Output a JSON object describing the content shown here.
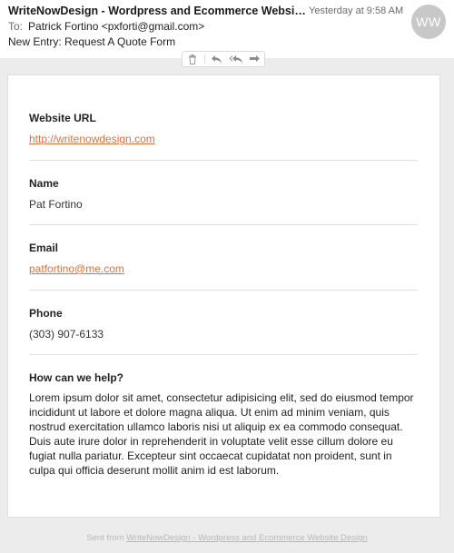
{
  "header": {
    "subject": "WriteNowDesign - Wordpress and Ecommerce Website De...",
    "date": "Yesterday at 9:58 AM",
    "to_prefix": "To:",
    "to_value": "Patrick Fortino <pxforti@gmail.com>",
    "email_title": "New Entry: Request A Quote Form",
    "avatar_initials": "WW"
  },
  "toolbar": {
    "icons": [
      "trash-icon",
      "reply-icon",
      "reply-all-icon",
      "forward-icon"
    ]
  },
  "form": {
    "website_url": {
      "label": "Website URL",
      "value": "http://writenowdesign.com"
    },
    "name": {
      "label": "Name",
      "value": "Pat Fortino"
    },
    "email": {
      "label": "Email",
      "value": "patfortino@me.com"
    },
    "phone": {
      "label": "Phone",
      "value": "(303) 907-6133"
    },
    "help": {
      "label": "How can we help?",
      "value": "Lorem ipsum dolor sit amet, consectetur adipisicing elit, sed do eiusmod tempor incididunt ut labore et dolore magna aliqua. Ut enim ad minim veniam, quis nostrud exercitation ullamco laboris nisi ut aliquip ex ea commodo consequat. Duis aute irure dolor in reprehenderit in voluptate velit esse cillum dolore eu fugiat nulla pariatur. Excepteur sint occaecat cupidatat non proident, sunt in culpa qui officia deserunt mollit anim id est laborum."
    }
  },
  "footer": {
    "prefix": "Sent from ",
    "link_text": "WriteNowDesign - Wordpress and Ecommerce Website Design"
  },
  "colors": {
    "link": "#e0703a",
    "body_background": "#ececec",
    "avatar_background": "#c8c8c8"
  }
}
